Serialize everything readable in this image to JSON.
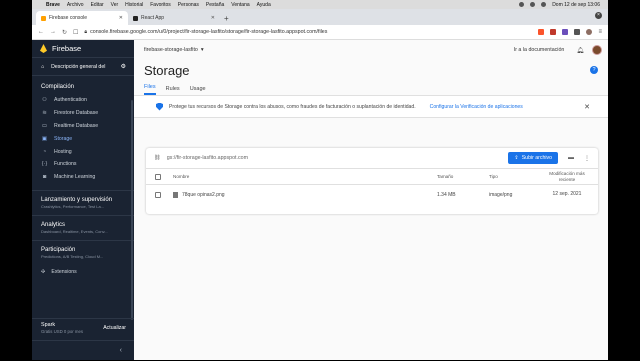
{
  "menubar": {
    "app": "Brave",
    "items": [
      "Archivo",
      "Editar",
      "Ver",
      "Historial",
      "Favoritos",
      "Personas",
      "Pestaña",
      "Ventana",
      "Ayuda"
    ],
    "datetime": "Dom 12 de sep  13:06"
  },
  "browser": {
    "tabs": [
      {
        "title": "Firebase console",
        "active": true
      },
      {
        "title": "React App",
        "active": false
      }
    ],
    "url": "console.firebase.google.com/u/0/project/fir-storage-lasfito/storage/fir-storage-lasfito.appspot.com/files"
  },
  "sidebar": {
    "brand": "Firebase",
    "overview": "Descripción general del",
    "sections": [
      {
        "title": "Compilación",
        "items": [
          {
            "label": "Authentication",
            "icon": "people-icon",
            "glyph": "⚇"
          },
          {
            "label": "Firestore Database",
            "icon": "firestore-icon",
            "glyph": "≋"
          },
          {
            "label": "Realtime Database",
            "icon": "database-icon",
            "glyph": "▭"
          },
          {
            "label": "Storage",
            "icon": "storage-icon",
            "glyph": "▣",
            "active": true
          },
          {
            "label": "Hosting",
            "icon": "hosting-icon",
            "glyph": "◔"
          },
          {
            "label": "Functions",
            "icon": "functions-icon",
            "glyph": "{·}"
          },
          {
            "label": "Machine Learning",
            "icon": "robot-icon",
            "glyph": "◙"
          }
        ]
      }
    ],
    "release": {
      "title": "Lanzamiento y supervisión",
      "sub": "Crashlytics, Performance, Test La..."
    },
    "analytics": {
      "title": "Analytics",
      "sub": "Dashboard, Realtime, Events, Conv..."
    },
    "engage": {
      "title": "Participación",
      "sub": "Predictions, A/B Testing, Cloud M..."
    },
    "extensions": "Extensions",
    "plan": {
      "name": "Spark",
      "price": "Gratis USD 0 por mes",
      "upgrade": "Actualizar"
    }
  },
  "topbar": {
    "project": "firebase-storage-lasfito",
    "docs": "Ir a la documentación"
  },
  "page": {
    "title": "Storage",
    "tabs": [
      "Files",
      "Rules",
      "Usage"
    ],
    "active_tab": "Files"
  },
  "notice": {
    "text": "Protege tus recursos de Storage contra los abusos, como fraudes de facturación o suplantación de identidad.",
    "link": "Configurar la Verificación de aplicaciones"
  },
  "bucket": {
    "path": "gs://fir-storage-lasfito.appspot.com",
    "upload": "Subir archivo"
  },
  "table": {
    "headers": {
      "name": "Nombre",
      "size": "Tamaño",
      "type": "Tipo",
      "modified_1": "Modificación más",
      "modified_2": "reciente"
    },
    "rows": [
      {
        "name": "78que opinas2.png",
        "size": "1.34 MB",
        "type": "image/png",
        "modified": "12 sep. 2021"
      }
    ]
  },
  "colors": {
    "accent": "#1a73e8",
    "sidebar": "#1a2332",
    "active_nav": "#8ab4f8"
  }
}
